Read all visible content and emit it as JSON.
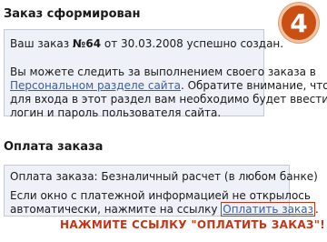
{
  "order_section": {
    "title": "Заказ сформирован",
    "line1_prefix": "Ваш заказ ",
    "order_number": "№64",
    "line1_suffix": " от 30.03.2008 успешно создан.",
    "para2_line1": "Вы можете следить за выполнением своего заказа в",
    "personal_link": "Персональном разделе сайта",
    "para2_line2_suffix": ". Обратите внимание, что",
    "para2_line3": "для входа в этот раздел вам необходимо будет ввести",
    "para2_line4": "логин и пароль пользователя сайта."
  },
  "payment_section": {
    "title": "Оплата заказа",
    "method_line": "Оплата заказа: Безналичный расчет (в любом банке)",
    "info_line1": "Если окно с платежной информацией не открылось",
    "info_line2_prefix": "автоматически, нажмите на ссылку ",
    "pay_link": "Оплатить заказ",
    "info_line2_suffix": "."
  },
  "step_badge": "4",
  "callout_text": "НАЖМИТЕ ССЫЛКУ \"ОПЛАТИТЬ ЗАКАЗ\"!",
  "colors": {
    "box_background": "#eef1f7",
    "link": "#3a5f9b",
    "accent_red": "#c0361a",
    "badge_orange": "#c94f13"
  }
}
